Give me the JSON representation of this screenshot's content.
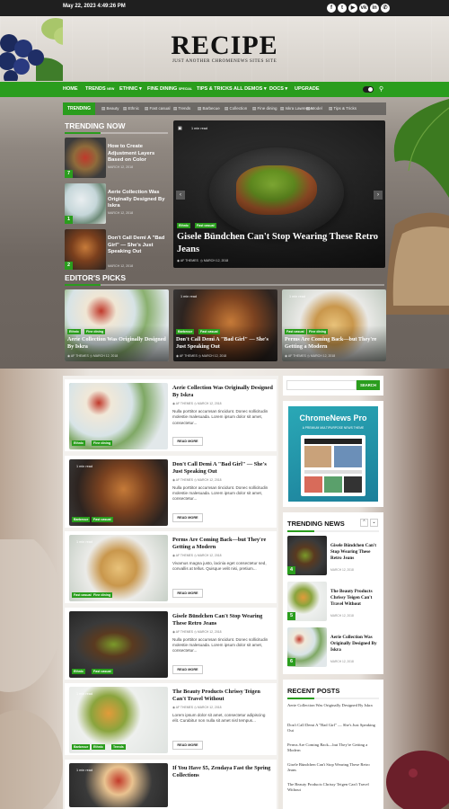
{
  "topbar": {
    "date": "May 22, 2023 4:49:26 PM",
    "social_icons": [
      "facebook-icon",
      "twitter-icon",
      "youtube-icon",
      "vk-icon",
      "linkedin-icon",
      "whatsapp-icon"
    ],
    "social_glyphs": [
      "f",
      "t",
      "▶",
      "vk",
      "in",
      "✆"
    ]
  },
  "site": {
    "title": "RECIPE",
    "tagline": "JUST ANOTHER CHROMENEWS SITES SITE"
  },
  "nav": {
    "items": [
      "HOME",
      "TRENDS",
      "ETHNIC",
      "FINE DINING",
      "TIPS & TRICKS",
      "ALL DEMOS",
      "DOCS",
      "UPGRADE"
    ],
    "badges": [
      "NEW",
      "SPECIAL"
    ],
    "dropdown_glyph": "▾",
    "search_glyph": "⚲"
  },
  "trending_bar": {
    "label": "TRENDING",
    "links": [
      "Beauty",
      "Ethnic",
      "Fast casual",
      "Trends",
      "Barbecue",
      "Collection",
      "Fine dining",
      "Iskra Lawrence",
      "Model",
      "Tips & Tricks"
    ]
  },
  "trending_now": {
    "heading": "TRENDING NOW",
    "items": [
      {
        "num": "7",
        "title": "How to Create Adjustment Layers Based on Color",
        "date": "MARCH 12, 2018"
      },
      {
        "num": "1",
        "title": "Aerie Collection Was Originally Designed By Iskra",
        "date": "MARCH 12, 2018"
      },
      {
        "num": "2",
        "title": "Don't Call Demi A \"Bad Girl\" — She's Just Speaking Out",
        "date": "MARCH 12, 2018"
      }
    ]
  },
  "hero": {
    "min_read": "1 min read",
    "tags": [
      "Ethnic",
      "Fast casual"
    ],
    "title": "Gisele Bündchen Can't Stop Wearing These Retro Jeans",
    "author": "AF THEMES",
    "date": "MARCH 12, 2018",
    "prev": "‹",
    "next": "›"
  },
  "editors_picks": {
    "heading": "EDITOR'S PICKS",
    "items": [
      {
        "title": "Aerie Collection Was Originally Designed By Iskra",
        "tags": [
          "Ethnic",
          "Fine dining"
        ],
        "min_read": "",
        "author": "AF THEMES",
        "date": "MARCH 12, 2018"
      },
      {
        "title": "Don't Call Demi A \"Bad Girl\" — She's Just Speaking Out",
        "tags": [
          "Barbecue",
          "Fast casual"
        ],
        "min_read": "1 min read",
        "author": "AF THEMES",
        "date": "MARCH 12, 2018"
      },
      {
        "title": "Perms Are Coming Back—but They're Getting a Modern",
        "tags": [
          "Fast casual",
          "Fine dining"
        ],
        "min_read": "1 min read",
        "author": "AF THEMES",
        "date": "MARCH 12, 2018"
      }
    ]
  },
  "posts": [
    {
      "title": "Aerie Collection Was Originally Designed By Iskra",
      "author": "AF THEMES",
      "date": "MARCH 12, 2018",
      "excerpt": "Nulla porttitor accumsan tincidunt. Donec sollicitudin molestie malesuada. Lorem ipsum dolor sit amet, consectetur...",
      "tags": [
        "Ethnic",
        "Fine dining"
      ],
      "min_read": "",
      "read_more": "READ MORE"
    },
    {
      "title": "Don't Call Demi A \"Bad Girl\" — She's Just Speaking Out",
      "author": "AF THEMES",
      "date": "MARCH 12, 2018",
      "excerpt": "Nulla porttitor accumsan tincidunt. Donec sollicitudin molestie malesuada. Lorem ipsum dolor sit amet, consectetur...",
      "tags": [
        "Barbecue",
        "Fast casual"
      ],
      "min_read": "1 min read",
      "read_more": "READ MORE"
    },
    {
      "title": "Perms Are Coming Back—but They're Getting a Modern",
      "author": "AF THEMES",
      "date": "MARCH 12, 2018",
      "excerpt": "Vivamus magna justo, lacinia eget consectetur sed, convallis at tellus. Quisque velit nisi, pretium...",
      "tags": [
        "Fast casual",
        "Fine dining"
      ],
      "min_read": "1 min read",
      "read_more": "READ MORE"
    },
    {
      "title": "Gisele Bündchen Can't Stop Wearing These Retro Jeans",
      "author": "AF THEMES",
      "date": "MARCH 12, 2018",
      "excerpt": "Nulla porttitor accumsan tincidunt. Donec sollicitudin molestie malesuada. Lorem ipsum dolor sit amet, consectetur...",
      "tags": [
        "Ethnic",
        "Fast casual"
      ],
      "min_read": "",
      "read_more": "READ MORE"
    },
    {
      "title": "The Beauty Products Chrissy Teigen Can't Travel Without",
      "author": "AF THEMES",
      "date": "MARCH 12, 2018",
      "excerpt": "Lorem ipsum dolor sit amet, consectetur adipiscing elit. Curabitur non nulla sit amet nisl tempus...",
      "tags": [
        "Barbecue",
        "Ethnic",
        "Trends"
      ],
      "min_read": "1 min read",
      "read_more": "READ MORE"
    },
    {
      "title": "If You Have $5, Zendaya Fast the Spring Collections",
      "author": "",
      "date": "",
      "excerpt": "",
      "tags": [],
      "min_read": "1 min read",
      "read_more": ""
    }
  ],
  "sidebar": {
    "search_button": "SEARCH",
    "search_placeholder": "",
    "ad": {
      "title": "ChromeNews Pro",
      "subtitle": "A PREMIUM MULTIPURPOSE NEWS THEME"
    },
    "trending_news": {
      "heading": "TRENDING NEWS",
      "items": [
        {
          "num": "4",
          "title": "Gisele Bündchen Can't Stop Wearing These Retro Jeans",
          "date": "MARCH 12, 2018"
        },
        {
          "num": "5",
          "title": "The Beauty Products Chrissy Teigen Can't Travel Without",
          "date": "MARCH 12, 2018"
        },
        {
          "num": "6",
          "title": "Aerie Collection Was Originally Designed By Iskra",
          "date": "MARCH 12, 2018"
        }
      ]
    },
    "recent_posts": {
      "heading": "RECENT POSTS",
      "items": [
        "Aerie Collection Was Originally Designed By Iskra",
        "Don't Call Demi A \"Bad Girl\" — She's Just Speaking Out",
        "Perms Are Coming Back—but They're Getting a Modern",
        "Gisele Bündchen Can't Stop Wearing These Retro Jeans",
        "The Beauty Products Chrissy Teigen Can't Travel Without"
      ]
    }
  },
  "colors": {
    "accent": "#2a9d1d",
    "dark": "#1f1f1f"
  }
}
